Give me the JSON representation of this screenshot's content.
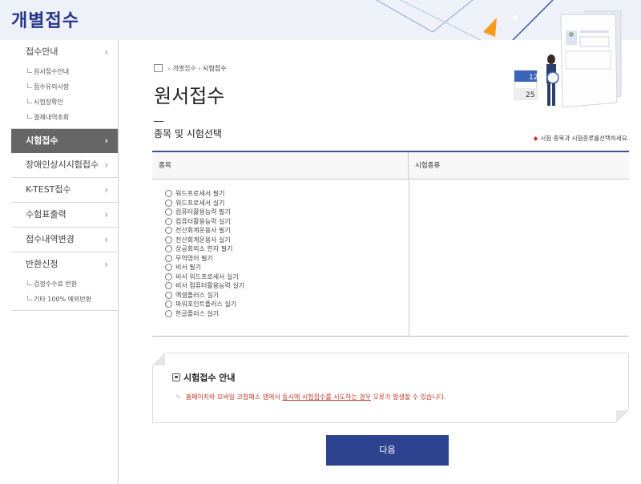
{
  "header": {
    "title": "개별접수"
  },
  "sidebar": {
    "sections": [
      {
        "label": "접수안내",
        "subs": [
          "원서접수안내",
          "접수유의사항",
          "시험장확인",
          "결제내역조회"
        ]
      },
      {
        "label": "시험접수",
        "active": true
      },
      {
        "label": "장애인상시시험접수"
      },
      {
        "label": "K-TEST접수"
      },
      {
        "label": "수험표출력"
      },
      {
        "label": "접수내역변경"
      },
      {
        "label": "반환신청",
        "subs": [
          "검정수수료 반환",
          "기타 100% 예외반환"
        ]
      }
    ],
    "chevron": "›"
  },
  "breadcrumb": {
    "items": [
      "개별접수",
      "시험접수"
    ]
  },
  "page_title": "원서접수",
  "section_title": "종목 및 시험선택",
  "section_note": "시험 종목과 시험종류를선택하세요.",
  "table": {
    "headers": [
      "종목",
      "시험종류"
    ],
    "options": [
      "워드프로세서 필기",
      "워드프로세서 실기",
      "컴퓨터활용능력 필기",
      "컴퓨터활용능력 실기",
      "전산회계운용사 필기",
      "전산회계운용사 실기",
      "상공회의소 한자 필기",
      "무역영어 필기",
      "비서 필기",
      "비서 워드프로세서 실기",
      "비서 컴퓨터활용능력 실기",
      "엑셀플러스 실기",
      "파워포인트플러스 실기",
      "한글플러스 실기"
    ]
  },
  "notice": {
    "title": "시험접수 안내",
    "text_before": "홈페이지와 모바일 코참패스 앱에서 ",
    "text_underlined": "동시에 시험접수를 시도하는 경우",
    "text_after": " 오류가 발생할 수 있습니다."
  },
  "next_button": "다음",
  "calendar": {
    "top": "12",
    "bottom": "25"
  },
  "colors": {
    "brand": "#26378a",
    "button": "#2e4390",
    "active_menu": "#666666",
    "notice_text": "#c0392b"
  }
}
